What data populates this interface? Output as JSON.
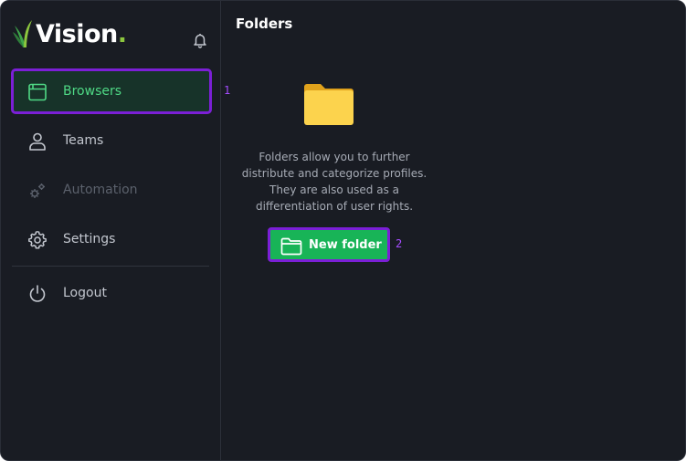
{
  "app": {
    "brand": "Vision",
    "brand_dot": "."
  },
  "sidebar": {
    "items": [
      {
        "label": "Browsers",
        "icon": "browser-window-icon",
        "state": "active",
        "marker": "1"
      },
      {
        "label": "Teams",
        "icon": "user-icon",
        "state": "normal"
      },
      {
        "label": "Automation",
        "icon": "gears-icon",
        "state": "disabled"
      },
      {
        "label": "Settings",
        "icon": "gear-icon",
        "state": "normal"
      },
      {
        "label": "Logout",
        "icon": "power-icon",
        "state": "normal"
      }
    ]
  },
  "main": {
    "title": "Folders",
    "description_lines": [
      "Folders allow you to further",
      "distribute and categorize profiles.",
      "They are also used as a",
      "differentiation of user rights."
    ],
    "new_folder_label": "New folder",
    "new_folder_marker": "2"
  },
  "colors": {
    "background": "#191c23",
    "accent_green": "#18b457",
    "active_text": "#4fd985",
    "highlight": "#7b1fd6",
    "folder_yellow": "#fcd34d"
  }
}
